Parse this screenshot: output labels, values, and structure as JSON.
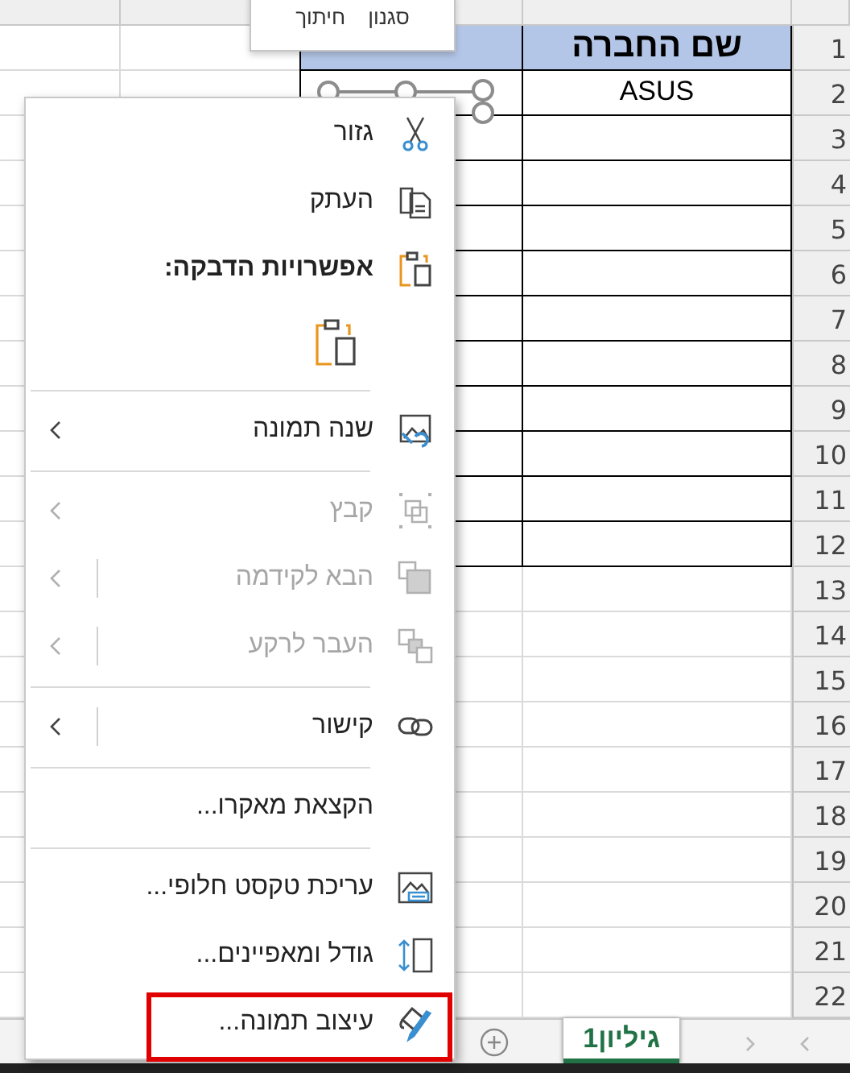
{
  "mini_toolbar": {
    "buttons": [
      "סגנון",
      "חיתוך"
    ]
  },
  "sheet": {
    "header_cell": "שם החברה",
    "rows": [
      {
        "company_name": "ASUS"
      }
    ],
    "row_numbers": [
      "1",
      "2",
      "3",
      "4",
      "5",
      "6",
      "7",
      "8",
      "9",
      "10",
      "11",
      "12",
      "13",
      "14",
      "15",
      "16",
      "17",
      "18",
      "19",
      "20",
      "21",
      "22"
    ]
  },
  "context_menu": {
    "items": [
      {
        "kind": "item",
        "label": "גזור",
        "disabled": false,
        "submenu": false,
        "split": false,
        "highlighted": false
      },
      {
        "kind": "item",
        "label": "העתק",
        "disabled": false,
        "submenu": false,
        "split": false,
        "highlighted": false
      },
      {
        "kind": "header",
        "label": "אפשרויות הדבקה:"
      },
      {
        "kind": "paste"
      },
      {
        "kind": "separator"
      },
      {
        "kind": "item",
        "label": "שנה תמונה",
        "disabled": false,
        "submenu": true,
        "split": false,
        "highlighted": false
      },
      {
        "kind": "separator"
      },
      {
        "kind": "item",
        "label": "קבץ",
        "disabled": true,
        "submenu": true,
        "split": false,
        "highlighted": false
      },
      {
        "kind": "item",
        "label": "הבא לקידמה",
        "disabled": true,
        "submenu": true,
        "split": true,
        "highlighted": false
      },
      {
        "kind": "item",
        "label": "העבר לרקע",
        "disabled": true,
        "submenu": true,
        "split": true,
        "highlighted": false
      },
      {
        "kind": "separator"
      },
      {
        "kind": "item",
        "label": "קישור",
        "disabled": false,
        "submenu": true,
        "split": true,
        "highlighted": false
      },
      {
        "kind": "separator"
      },
      {
        "kind": "item",
        "label": "הקצאת מאקרו...",
        "disabled": false,
        "submenu": false,
        "split": false,
        "highlighted": false
      },
      {
        "kind": "separator"
      },
      {
        "kind": "item",
        "label": "עריכת טקסט חלופי...",
        "disabled": false,
        "submenu": false,
        "split": false,
        "highlighted": false
      },
      {
        "kind": "item",
        "label": "גודל ומאפיינים...",
        "disabled": false,
        "submenu": false,
        "split": false,
        "highlighted": false
      },
      {
        "kind": "item",
        "label": "עיצוב תמונה...",
        "disabled": false,
        "submenu": false,
        "split": false,
        "highlighted": true
      }
    ]
  },
  "sheet_tabs": [
    {
      "label": "גיליון1",
      "selected": true
    }
  ]
}
